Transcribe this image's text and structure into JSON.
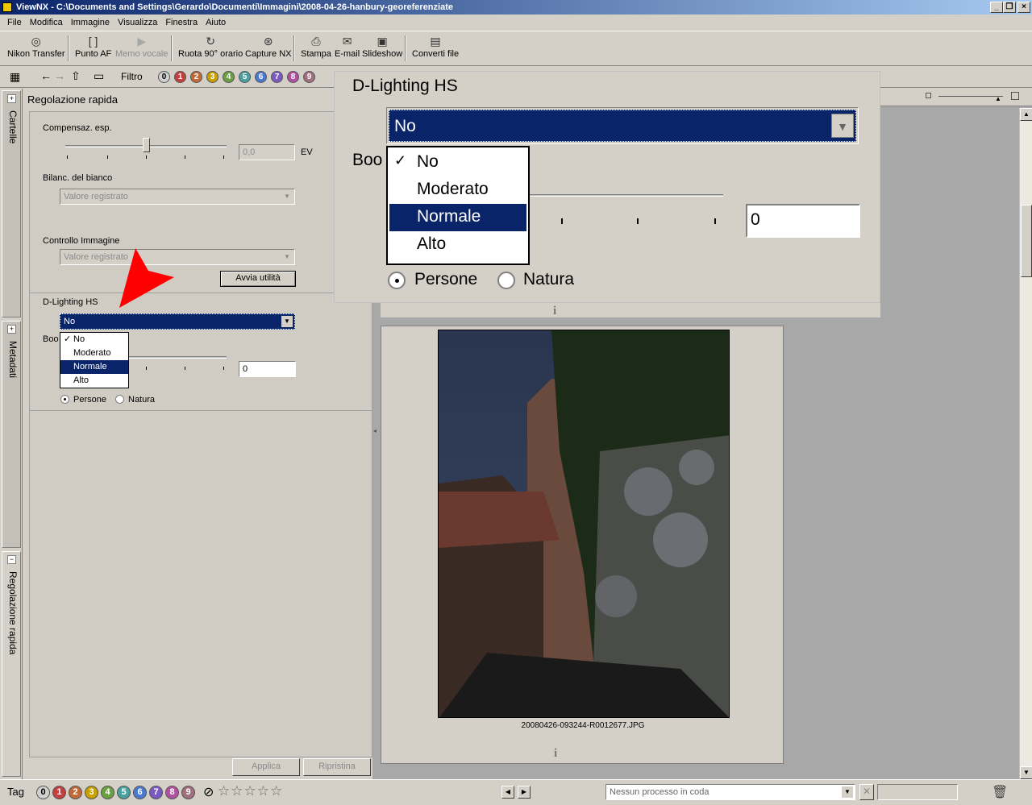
{
  "window": {
    "title": "ViewNX - C:\\Documents and Settings\\Gerardo\\Documenti\\Immagini\\2008-04-26-hanbury-georeferenziate"
  },
  "menu": [
    "File",
    "Modifica",
    "Immagine",
    "Visualizza",
    "Finestra",
    "Aiuto"
  ],
  "toolbar": {
    "nikon_transfer": "Nikon Transfer",
    "punto_af": "Punto AF",
    "memo_vocale": "Memo vocale",
    "ruota": "Ruota 90° orario",
    "capture_nx": "Capture NX",
    "stampa": "Stampa",
    "email": "E-mail",
    "slideshow": "Slideshow",
    "converti": "Converti file"
  },
  "filterbar": {
    "label": "Filtro",
    "ratings": [
      "0",
      "1",
      "2",
      "3",
      "4",
      "5",
      "6",
      "7",
      "8",
      "9"
    ]
  },
  "colors": {
    "label_colors": [
      "#d0d0d0",
      "#c44040",
      "#c06a3a",
      "#c8a000",
      "#6aa040",
      "#4aa0a0",
      "#4a7ad0",
      "#7a5ac0",
      "#b050a0",
      "#a07080"
    ],
    "selection": "#0a246a",
    "arrow": "#ff0000"
  },
  "sidetabs": {
    "cartelle": "Cartelle",
    "metadati": "Metadati",
    "regolazione": "Regolazione rapida"
  },
  "panel": {
    "title": "Regolazione rapida",
    "compensaz_label": "Compensaz. esp.",
    "compensaz_value": "0,0",
    "ev_unit": "EV",
    "bilanc_label": "Bilanc. del bianco",
    "bilanc_value": "Valore registrato",
    "controllo_label": "Controllo Immagine",
    "controllo_value": "Valore registrato",
    "avvia_button": "Avvia utilità",
    "dlighting_label": "D-Lighting HS",
    "dlighting_value": "No",
    "boost_label": "Boo",
    "boost_value": "0",
    "dropdown": [
      "No",
      "Moderato",
      "Normale",
      "Alto"
    ],
    "radio_persone": "Persone",
    "radio_natura": "Natura",
    "applica": "Applica",
    "ripristina": "Ripristina"
  },
  "zoom": {
    "title": "D-Lighting HS",
    "value": "No",
    "boost_label": "Boo",
    "boost_value": "0",
    "dropdown": [
      "No",
      "Moderato",
      "Normale",
      "Alto"
    ],
    "radio_persone": "Persone",
    "radio_natura": "Natura"
  },
  "viewer": {
    "info_top": "i",
    "filename": "20080426-093244-R0012677.JPG",
    "info_bottom": "i"
  },
  "statusbar": {
    "tag": "Tag",
    "ratings": [
      "0",
      "1",
      "2",
      "3",
      "4",
      "5",
      "6",
      "7",
      "8",
      "9"
    ],
    "stars": "☆☆☆☆☆",
    "queue": "Nessun processo in coda"
  }
}
